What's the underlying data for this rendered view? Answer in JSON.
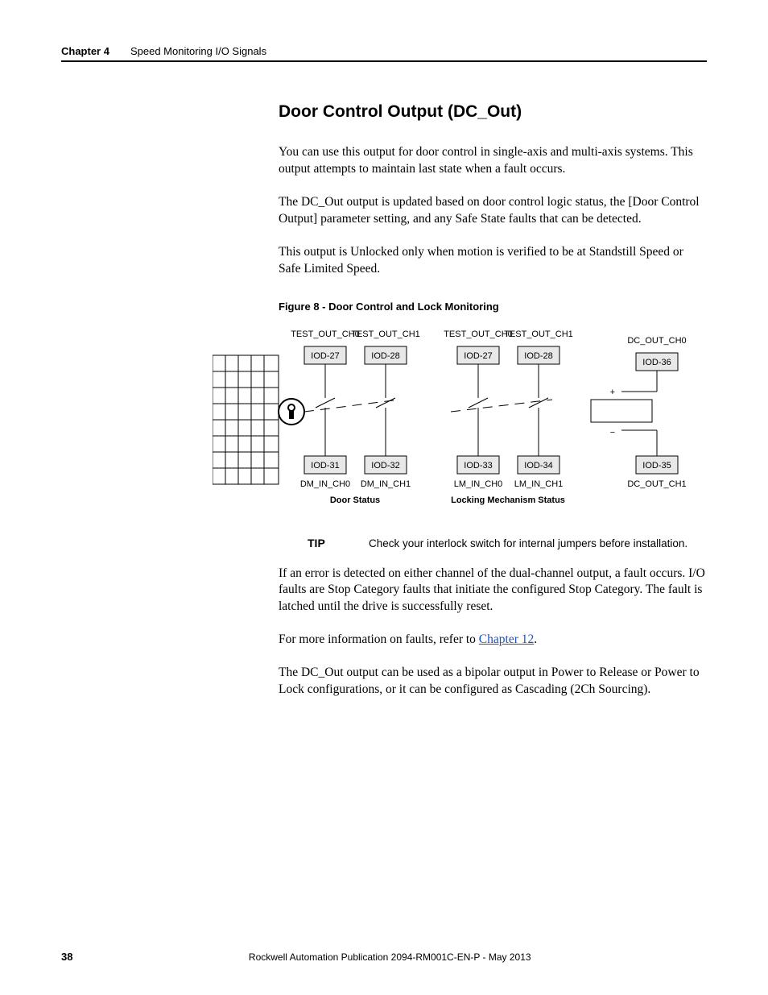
{
  "header": {
    "chapter": "Chapter 4",
    "section": "Speed Monitoring I/O Signals"
  },
  "title": "Door Control Output (DC_Out)",
  "p1": "You can use this output for door control in single-axis and multi-axis systems. This output attempts to maintain last state when a fault occurs.",
  "p2": "The DC_Out output is updated based on door control logic status, the [Door Control Output] parameter setting, and any Safe State faults that can be detected.",
  "p3": "This output is Unlocked only when motion is verified to be at Standstill Speed or Safe Limited Speed.",
  "figcap": "Figure 8 - Door Control and Lock Monitoring",
  "diagram": {
    "top_labels": [
      "TEST_OUT_CH0",
      "TEST_OUT_CH1",
      "TEST_OUT_CH0",
      "TEST_OUT_CH1",
      "DC_OUT_CH0"
    ],
    "top_ids": [
      "IOD-27",
      "IOD-28",
      "IOD-27",
      "IOD-28",
      "IOD-36"
    ],
    "bot_ids": [
      "IOD-31",
      "IOD-32",
      "IOD-33",
      "IOD-34",
      "IOD-35"
    ],
    "bot_labels": [
      "DM_IN_CH0",
      "DM_IN_CH1",
      "LM_IN_CH0",
      "LM_IN_CH1",
      "DC_OUT_CH1"
    ],
    "group_left": "Door Status",
    "group_right": "Locking Mechanism Status",
    "plus": "+",
    "minus": "−"
  },
  "tip": {
    "label": "TIP",
    "text": "Check your interlock switch for internal jumpers before installation."
  },
  "p4": "If an error is detected on either channel of the dual-channel output, a fault occurs. I/O faults are Stop Category faults that initiate the configured Stop Category. The fault is latched until the drive is successfully reset.",
  "p5a": "For more information on faults, refer to ",
  "p5link": "Chapter 12",
  "p5b": ".",
  "p6": "The DC_Out output can be used as a bipolar output in Power to Release or Power to Lock configurations, or it can be configured as Cascading (2Ch Sourcing).",
  "footer": {
    "page": "38",
    "pub": "Rockwell Automation Publication 2094-RM001C-EN-P - May 2013"
  }
}
